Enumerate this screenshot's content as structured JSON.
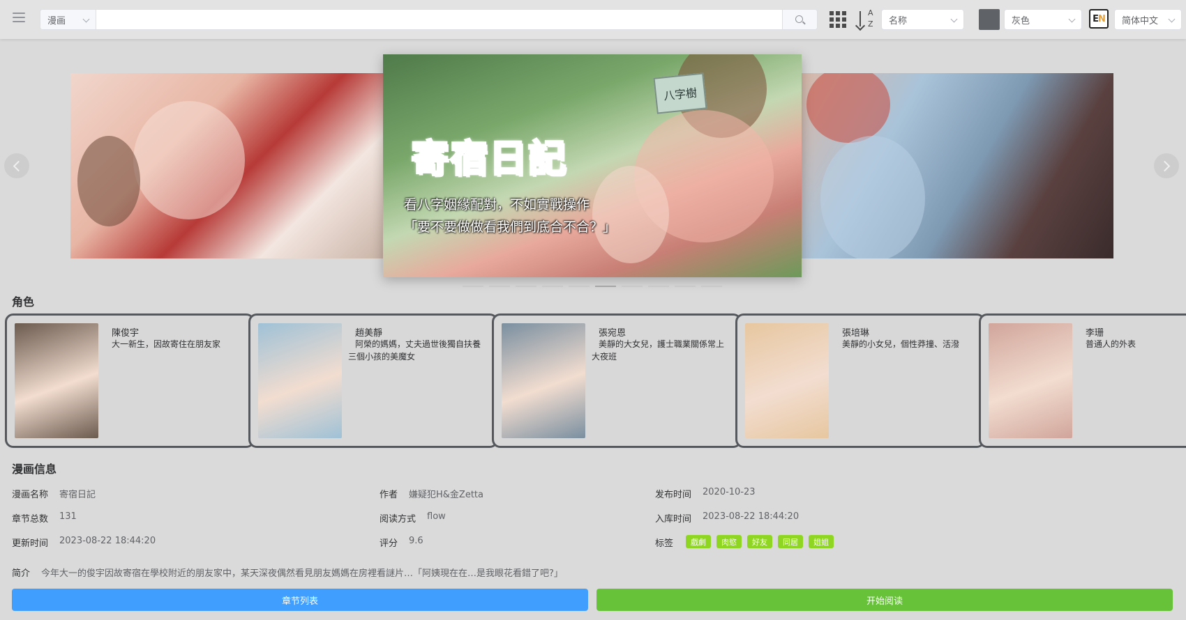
{
  "header": {
    "category": "漫画",
    "search_placeholder": "",
    "sort_field": "名称",
    "theme": "灰色",
    "language": "简体中文",
    "lang_icon_e": "E",
    "lang_icon_n": "N",
    "sort_a": "A",
    "sort_z": "Z"
  },
  "carousel": {
    "title_art": "寄宿日記",
    "sign_text": "八字樹",
    "tagline_1": "看八字姻緣配對，不如實戰操作",
    "tagline_2": "「要不要做做看我們到底合不合？」",
    "slide_count": 10,
    "active_index": 5
  },
  "characters": {
    "title": "角色",
    "items": [
      {
        "name": "陳俊宇",
        "desc": "大一新生，因故寄住在朋友家",
        "avatar_color": "#6b5a4e"
      },
      {
        "name": "趙美靜",
        "desc": "阿榮的媽媽，丈夫過世後獨自扶養三個小孩的美魔女",
        "avatar_color": "#9fc1d6"
      },
      {
        "name": "張宛恩",
        "desc": "美靜的大女兒，護士職業關係常上大夜班",
        "avatar_color": "#7a8fa0"
      },
      {
        "name": "張培琳",
        "desc": "美靜的小女兒，個性莽撞、活潑",
        "avatar_color": "#e7c7a0"
      },
      {
        "name": "李珊",
        "desc": "普通人的外表",
        "avatar_color": "#d1a59b"
      }
    ]
  },
  "info": {
    "title": "漫画信息",
    "name_label": "漫画名称",
    "name_value": "寄宿日記",
    "author_label": "作者",
    "author_value": "嫌疑犯H&金Zetta",
    "publish_label": "发布时间",
    "publish_value": "2020-10-23",
    "chapters_label": "章节总数",
    "chapters_value": "131",
    "mode_label": "阅读方式",
    "mode_value": "flow",
    "stored_label": "入库时间",
    "stored_value": "2023-08-22 18:44:20",
    "updated_label": "更新时间",
    "updated_value": "2023-08-22 18:44:20",
    "rating_label": "评分",
    "rating_value": "9.6",
    "tags_label": "标签",
    "tags": [
      "戲劇",
      "肉慾",
      "好友",
      "同居",
      "姐姐"
    ],
    "summary_label": "简介",
    "summary_value": "今年大一的俊宇因故寄宿在學校附近的朋友家中，某天深夜偶然看見朋友媽媽在房裡看謎片…「阿姨現在在…是我眼花看錯了吧?」"
  },
  "actions": {
    "chapter_list": "章节列表",
    "start_reading": "开始阅读"
  }
}
